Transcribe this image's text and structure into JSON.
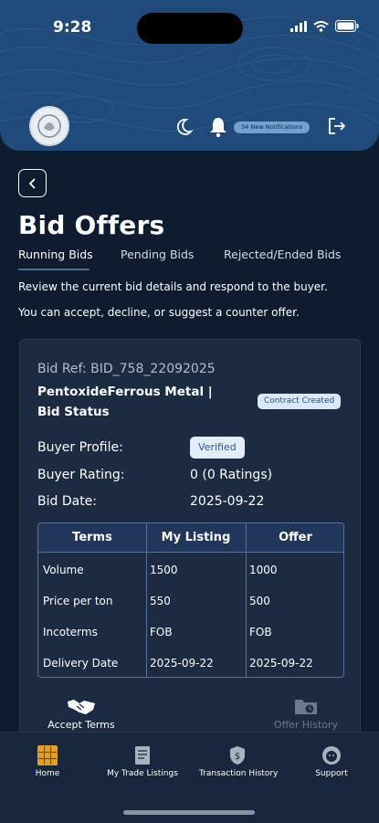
{
  "status_bar": {
    "time": "9:28"
  },
  "header": {
    "notification_text": "34 New Notifications",
    "colors": {
      "background": "#1f4a7a",
      "pill": "#6f9fd3"
    }
  },
  "page": {
    "title": "Bid Offers",
    "tabs": [
      {
        "label": "Running Bids",
        "active": true
      },
      {
        "label": "Pending Bids",
        "active": false
      },
      {
        "label": "Rejected/Ended Bids",
        "active": false
      }
    ],
    "description_line1": "Review the current bid details and respond to the buyer.",
    "description_line2": "You can accept, decline, or suggest a counter offer."
  },
  "bid_card": {
    "ref": "Bid Ref: BID_758_22092025",
    "title": "PentoxideFerrous Metal | Bid Status",
    "status_badge": "Contract Created",
    "buyer_profile_label": "Buyer Profile:",
    "buyer_profile_value": "Verified",
    "buyer_rating_label": "Buyer Rating:",
    "buyer_rating_value": "0 (0 Ratings)",
    "bid_date_label": "Bid Date:",
    "bid_date_value": "2025-09-22",
    "table": {
      "headers": [
        "Terms",
        "My Listing",
        "Offer"
      ],
      "rows": [
        [
          "Volume",
          "1500",
          "1000"
        ],
        [
          "Price per ton",
          "550",
          "500"
        ],
        [
          "Incoterms",
          "FOB",
          "FOB"
        ],
        [
          "Delivery Date",
          "2025-09-22",
          "2025-09-22"
        ]
      ]
    },
    "actions": {
      "accept_label": "Accept Terms",
      "history_label": "Offer History"
    }
  },
  "bottom_nav": {
    "items": [
      {
        "label": "Home",
        "icon": "home-grid-icon"
      },
      {
        "label": "My Trade Listings",
        "icon": "document-icon"
      },
      {
        "label": "Transaction History",
        "icon": "shield-dollar-icon"
      },
      {
        "label": "Support",
        "icon": "support-face-icon"
      }
    ]
  }
}
